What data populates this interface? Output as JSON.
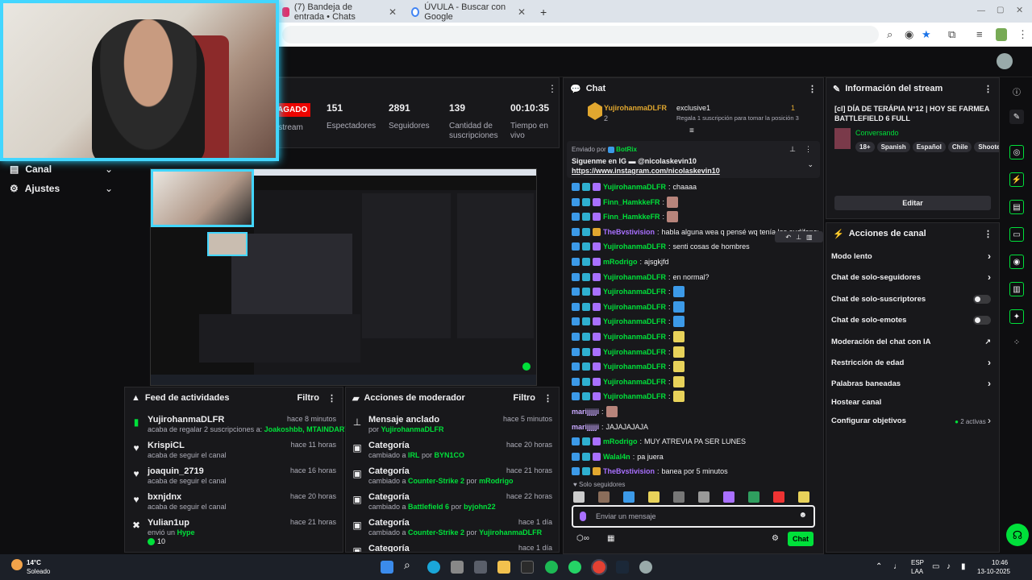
{
  "browser": {
    "tabs": [
      {
        "label": "(7) Bandeja de entrada • Chats",
        "color": "#e1306c"
      },
      {
        "label": "ÚVULA - Buscar con Google",
        "color": "#4285f4"
      }
    ],
    "tab_add": "+"
  },
  "stats": {
    "live_badge": "AGADO",
    "stream_label": "istream",
    "items": [
      {
        "value": "151",
        "label": "Espectadores"
      },
      {
        "value": "2891",
        "label": "Seguidores"
      },
      {
        "value": "139",
        "label": "Cantidad de suscripciones"
      },
      {
        "value": "00:10:35",
        "label": "Tiempo en vivo"
      }
    ]
  },
  "nav": {
    "canal": "Canal",
    "ajustes": "Ajustes"
  },
  "feed": {
    "title": "Feed de actividades",
    "filter": "Filtro",
    "items": [
      {
        "icon": "gift-icon",
        "name": "YujirohanmaDLFR",
        "time": "hace 8 minutos",
        "sub_a": "acaba de regalar 2 suscripciones a: ",
        "sub_b": "Joakoshbb, MTAINDARY"
      },
      {
        "icon": "heart-icon",
        "name": "KrispiCL",
        "time": "hace 11 horas",
        "sub_a": "acaba de seguir el canal",
        "sub_b": ""
      },
      {
        "icon": "heart-icon",
        "name": "joaquin_2719",
        "time": "hace 16 horas",
        "sub_a": "acaba de seguir el canal",
        "sub_b": ""
      },
      {
        "icon": "heart-icon",
        "name": "bxnjdnx",
        "time": "hace 20 horas",
        "sub_a": "acaba de seguir el canal",
        "sub_b": ""
      },
      {
        "icon": "hype-icon",
        "name": "Yulian1up",
        "time": "hace 21 horas",
        "sub_a": "envió un ",
        "sub_b": "Hype",
        "extra": "10"
      }
    ]
  },
  "mod": {
    "title": "Acciones de moderador",
    "filter": "Filtro",
    "items": [
      {
        "icon": "pin-icon",
        "name": "Mensaje anclado",
        "time": "hace 5 minutos",
        "sub_a": "por ",
        "sub_b": "YujirohanmaDLFR",
        "sub_c": "",
        "sub_d": ""
      },
      {
        "icon": "category-icon",
        "name": "Categoría",
        "time": "hace 20 horas",
        "sub_a": "cambiado a ",
        "sub_b": "IRL",
        "sub_c": " por ",
        "sub_d": "BYN1CO"
      },
      {
        "icon": "category-icon",
        "name": "Categoría",
        "time": "hace 21 horas",
        "sub_a": "cambiado a ",
        "sub_b": "Counter-Strike 2",
        "sub_c": " por ",
        "sub_d": "mRodrigo"
      },
      {
        "icon": "category-icon",
        "name": "Categoría",
        "time": "hace 22 horas",
        "sub_a": "cambiado a ",
        "sub_b": "Battlefield 6",
        "sub_c": " por ",
        "sub_d": "byjohn22"
      },
      {
        "icon": "category-icon",
        "name": "Categoría",
        "time": "hace 1 día",
        "sub_a": "cambiado a ",
        "sub_b": "Counter-Strike 2",
        "sub_c": " por ",
        "sub_d": "YujirohanmaDLFR"
      },
      {
        "icon": "category-icon",
        "name": "Categoría",
        "time": "hace 1 día",
        "sub_a": "",
        "sub_b": "",
        "sub_c": "",
        "sub_d": ""
      }
    ]
  },
  "chat": {
    "title": "Chat",
    "top_gifter": {
      "name": "YujirohanmaDLFR",
      "count": "2",
      "tag": "exclusive1",
      "tag_count": "1",
      "promo": "Regala 1 suscripción para tomar la posición 3"
    },
    "pinned": {
      "sent_by": "Enviado por",
      "bot": "BotRix",
      "line1": "Siguenme en IG",
      "mention": "@nicolaskevin10",
      "link": "https://www.instagram.com/nicolaskevin10"
    },
    "messages": [
      {
        "user": "YujirohanmaDLFR",
        "color": "#00e03a",
        "text": "chaaaa",
        "emote": ""
      },
      {
        "user": "Finn_HamkkeFR",
        "color": "#00e03a",
        "text": "",
        "emote": "pic"
      },
      {
        "user": "Finn_HamkkeFR",
        "color": "#00e03a",
        "text": "",
        "emote": "pic"
      },
      {
        "user": "TheBvstivision",
        "color": "#a970ff",
        "text": "habla alguna wea q pensé wq tenía los audífonos malos",
        "emote": ""
      },
      {
        "user": "YujirohanmaDLFR",
        "color": "#00e03a",
        "text": "senti cosas de hombres",
        "emote": ""
      },
      {
        "user": "mRodrigo",
        "color": "#00e03a",
        "text": "ajsgkjfd",
        "emote": ""
      },
      {
        "user": "YujirohanmaDLFR",
        "color": "#00e03a",
        "text": "en normal?",
        "emote": ""
      },
      {
        "user": "YujirohanmaDLFR",
        "color": "#00e03a",
        "text": "",
        "emote": "VALE"
      },
      {
        "user": "YujirohanmaDLFR",
        "color": "#00e03a",
        "text": "",
        "emote": "VALE"
      },
      {
        "user": "YujirohanmaDLFR",
        "color": "#00e03a",
        "text": "",
        "emote": "VALE"
      },
      {
        "user": "YujirohanmaDLFR",
        "color": "#00e03a",
        "text": "",
        "emote": "minion"
      },
      {
        "user": "YujirohanmaDLFR",
        "color": "#00e03a",
        "text": "",
        "emote": "minion"
      },
      {
        "user": "YujirohanmaDLFR",
        "color": "#00e03a",
        "text": "",
        "emote": "minion"
      },
      {
        "user": "YujirohanmaDLFR",
        "color": "#00e03a",
        "text": "",
        "emote": "minion"
      },
      {
        "user": "YujirohanmaDLFR",
        "color": "#00e03a",
        "text": "",
        "emote": "minion"
      },
      {
        "user": "marijjjjji",
        "color": "#c9a9ff",
        "text": "",
        "emote": "pic"
      },
      {
        "user": "marijjjjji",
        "color": "#c9a9ff",
        "text": "JAJAJAJAJA",
        "emote": ""
      },
      {
        "user": "mRodrigo",
        "color": "#00e03a",
        "text": "MUY ATREVIA PA SER LUNES",
        "emote": ""
      },
      {
        "user": "Walal4n",
        "color": "#00e03a",
        "text": "pa juera",
        "emote": ""
      },
      {
        "user": "TheBvstivision",
        "color": "#a970ff",
        "text": "banea por 5 minutos",
        "emote": ""
      }
    ],
    "followers_only": "Solo seguidores",
    "input_placeholder": "Enviar un mensaje",
    "send_label": "Chat"
  },
  "info": {
    "title": "Información del stream",
    "stream_title": "[cl] DÍA DE TERÁPIA N°12 | HOY SE FARMEA BATTLEFIELD 6 FULL",
    "category": "Conversando",
    "tags": [
      "18+",
      "Spanish",
      "Español",
      "Chile",
      "Shoote"
    ],
    "edit": "Editar"
  },
  "actions": {
    "title": "Acciones de canal",
    "items": [
      {
        "label": "Modo lento",
        "kind": "chevron",
        "extra": ""
      },
      {
        "label": "Chat de solo-seguidores",
        "kind": "chevron",
        "extra": ""
      },
      {
        "label": "Chat de solo-suscriptores",
        "kind": "toggle",
        "extra": ""
      },
      {
        "label": "Chat de solo-emotes",
        "kind": "toggle",
        "extra": ""
      },
      {
        "label": "Moderación del chat con IA",
        "kind": "external",
        "extra": ""
      },
      {
        "label": "Restricción de edad",
        "kind": "chevron",
        "extra": ""
      },
      {
        "label": "Palabras baneadas",
        "kind": "chevron",
        "extra": ""
      },
      {
        "label": "Hostear canal",
        "kind": "none",
        "extra": ""
      },
      {
        "label": "Configurar objetivos",
        "kind": "chevron",
        "extra": "2 activas"
      }
    ]
  },
  "taskbar": {
    "weather_temp": "14°C",
    "weather_desc": "Soleado",
    "lang": "ESP",
    "lang2": "LAA",
    "time": "10:46",
    "date": "13-10-2025"
  }
}
